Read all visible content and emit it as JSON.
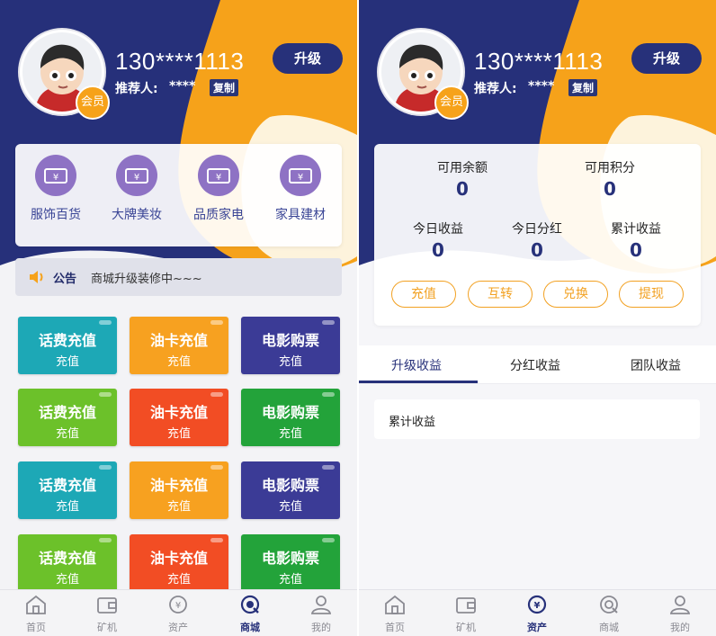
{
  "colors": {
    "navy": "#27317a",
    "orange": "#f6a21a",
    "cream": "#fdf3dc",
    "purple_icon": "#8e72c4",
    "accent_orange": "#f2a122"
  },
  "user": {
    "phone": "130****1113",
    "referrer_label": "推荐人:",
    "referrer_value": "****",
    "copy_label": "复制",
    "member_badge": "会员",
    "upgrade_label": "升级"
  },
  "left": {
    "categories": [
      {
        "label": "服饰百货",
        "icon": "coupon-icon"
      },
      {
        "label": "大牌美妆",
        "icon": "coupon-icon"
      },
      {
        "label": "品质家电",
        "icon": "coupon-icon"
      },
      {
        "label": "家具建材",
        "icon": "coupon-icon"
      }
    ],
    "notice": {
      "title": "公告",
      "text": "商城升级装修中~~~",
      "icon": "speaker-icon"
    },
    "tiles": [
      {
        "title": "话费充值",
        "sub": "充值",
        "color": "#1da8b6"
      },
      {
        "title": "油卡充值",
        "sub": "充值",
        "color": "#f7a120"
      },
      {
        "title": "电影购票",
        "sub": "充值",
        "color": "#3b3b96"
      },
      {
        "title": "话费充值",
        "sub": "充值",
        "color": "#6cc12a"
      },
      {
        "title": "油卡充值",
        "sub": "充值",
        "color": "#f24d24"
      },
      {
        "title": "电影购票",
        "sub": "充值",
        "color": "#23a33a"
      },
      {
        "title": "话费充值",
        "sub": "充值",
        "color": "#1da8b6"
      },
      {
        "title": "油卡充值",
        "sub": "充值",
        "color": "#f7a120"
      },
      {
        "title": "电影购票",
        "sub": "充值",
        "color": "#3b3b96"
      },
      {
        "title": "话费充值",
        "sub": "充值",
        "color": "#6cc12a"
      },
      {
        "title": "油卡充值",
        "sub": "充值",
        "color": "#f24d24"
      },
      {
        "title": "电影购票",
        "sub": "充值",
        "color": "#23a33a"
      }
    ]
  },
  "right": {
    "balances": [
      {
        "label": "可用余额",
        "value": "0"
      },
      {
        "label": "可用积分",
        "value": "0"
      }
    ],
    "earnings": [
      {
        "label": "今日收益",
        "value": "0"
      },
      {
        "label": "今日分红",
        "value": "0"
      },
      {
        "label": "累计收益",
        "value": "0"
      }
    ],
    "actions": [
      "充值",
      "互转",
      "兑换",
      "提现"
    ],
    "tabs": [
      "升级收益",
      "分红收益",
      "团队收益"
    ],
    "card_label": "累计收益"
  },
  "nav": {
    "items": [
      {
        "label": "首页",
        "icon": "home-icon"
      },
      {
        "label": "矿机",
        "icon": "wallet-icon"
      },
      {
        "label": "资产",
        "icon": "asset-icon"
      },
      {
        "label": "商城",
        "icon": "mall-icon"
      },
      {
        "label": "我的",
        "icon": "user-icon"
      }
    ],
    "left_active": "商城",
    "right_active": "资产"
  }
}
